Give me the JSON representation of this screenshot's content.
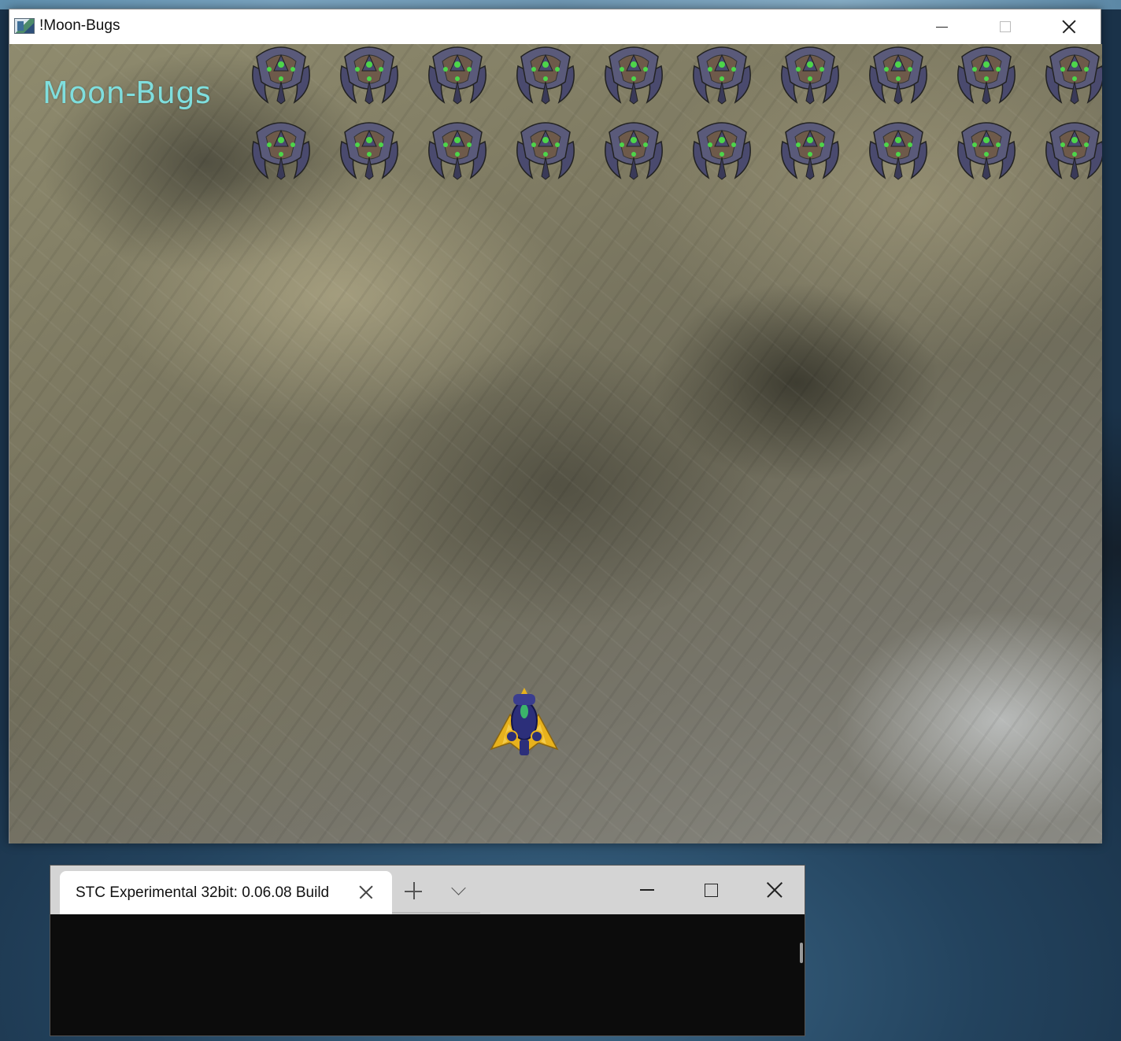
{
  "game_window": {
    "title": "!Moon-Bugs",
    "game_title": "Moon-Bugs",
    "bug_rows": 2,
    "bug_columns": 10
  },
  "terminal_window": {
    "tab_label": "STC Experimental 32bit: 0.06.08 Build"
  },
  "colors": {
    "game_title": "#7fdedd",
    "bug_body": "#4a4a6e",
    "bug_accent": "#4dd64a",
    "ship_body": "#e8b21d",
    "ship_core": "#2c2f7a"
  }
}
